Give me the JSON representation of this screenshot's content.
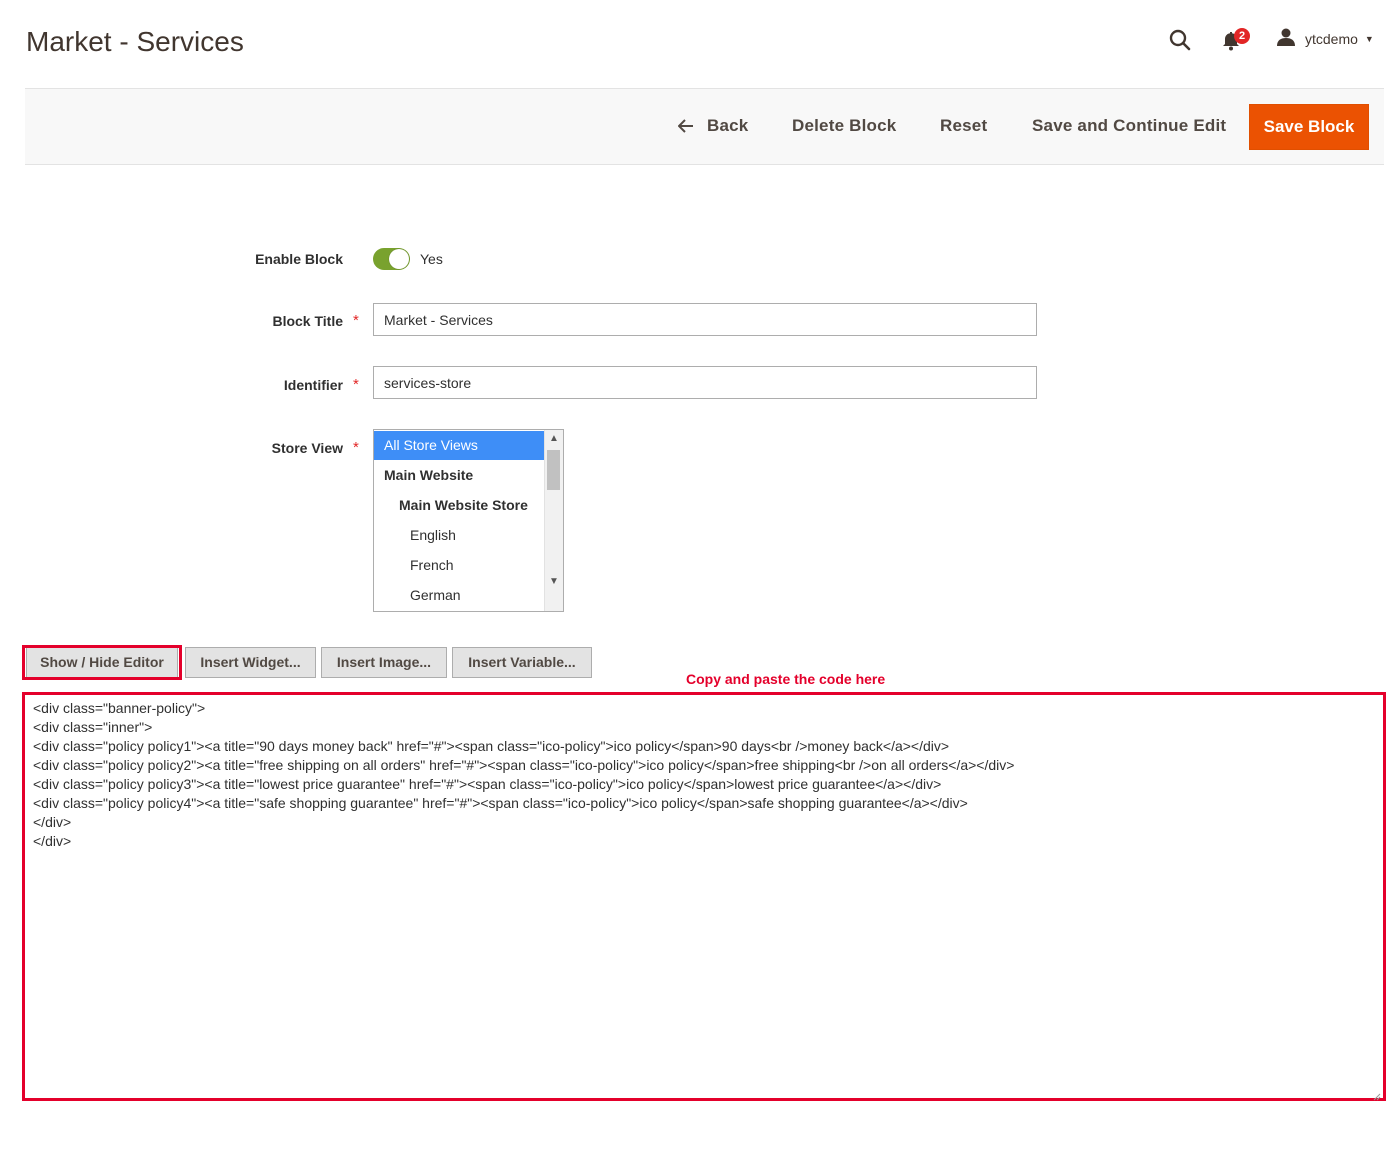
{
  "header": {
    "title": "Market - Services",
    "notifications_count": "2",
    "username": "ytcdemo",
    "icons": [
      "search-icon",
      "bell-icon",
      "user-icon",
      "caret-down-icon"
    ]
  },
  "toolbar": {
    "back_label": "Back",
    "delete_label": "Delete Block",
    "reset_label": "Reset",
    "save_continue_label": "Save and Continue Edit",
    "save_label": "Save Block",
    "save_color": "#eb5202"
  },
  "form": {
    "enable_block": {
      "label": "Enable Block",
      "value": "Yes",
      "on": true
    },
    "block_title": {
      "label": "Block Title",
      "value": "Market - Services"
    },
    "identifier": {
      "label": "Identifier",
      "value": "services-store"
    },
    "store_view": {
      "label": "Store View",
      "options": [
        {
          "label": "All Store Views",
          "selected": true
        },
        {
          "label": "Main Website"
        },
        {
          "label": "Main Website Store"
        },
        {
          "label": "English"
        },
        {
          "label": "French"
        },
        {
          "label": "German"
        }
      ]
    }
  },
  "editor": {
    "show_hide_label": "Show / Hide Editor",
    "insert_widget_label": "Insert Widget...",
    "insert_image_label": "Insert Image...",
    "insert_variable_label": "Insert Variable...",
    "annotation": "Copy and paste the code here",
    "annotation_color": "#e4002b",
    "code_lines": [
      "<div class=\"banner-policy\">",
      "<div class=\"inner\">",
      "<div class=\"policy policy1\"><a title=\"90 days money back\" href=\"#\"><span class=\"ico-policy\">ico policy</span>90 days<br />money back</a></div>",
      "<div class=\"policy policy2\"><a title=\"free shipping on all orders\" href=\"#\"><span class=\"ico-policy\">ico policy</span>free shipping<br />on all orders</a></div>",
      "<div class=\"policy policy3\"><a title=\"lowest price guarantee\" href=\"#\"><span class=\"ico-policy\">ico policy</span>lowest price guarantee</a></div>",
      "<div class=\"policy policy4\"><a title=\"safe shopping guarantee\" href=\"#\"><span class=\"ico-policy\">ico policy</span>safe shopping guarantee</a></div>",
      "</div>",
      "</div>"
    ]
  }
}
